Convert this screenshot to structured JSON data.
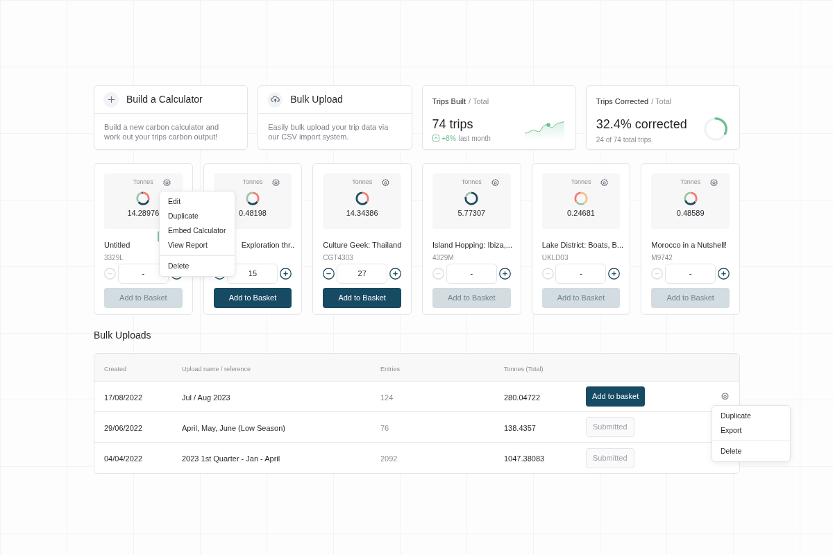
{
  "actions": [
    {
      "kind": "build",
      "title": "Build a Calculator",
      "description": "Build a new carbon calculator and work out your trips carbon output!"
    },
    {
      "kind": "upload",
      "title": "Bulk Upload",
      "description": "Easily bulk upload your trip data via our CSV import system."
    }
  ],
  "stats": [
    {
      "kind": "sparkline",
      "title": "Trips Built",
      "subtitle": "/ Total",
      "value": "74 trips",
      "change": "+8%",
      "change_note": "last month"
    },
    {
      "kind": "ring",
      "title": "Trips Corrected",
      "subtitle": "/ Total",
      "value": "32.4% corrected",
      "note": "24 of 74 total trips",
      "level": 0.324
    }
  ],
  "trips": [
    {
      "unit": "Tonnes",
      "tonnes": "14.28976",
      "name": "Untitled",
      "code": "3329L",
      "quantity": "-",
      "can_decrease": false,
      "can_add": false,
      "badge": true,
      "button": "Add to Basket"
    },
    {
      "unit": "Tonnes",
      "tonnes": "0.48198",
      "name": "Exploration thr..",
      "hidden_start": true,
      "quantity": "15",
      "can_decrease": true,
      "can_add": true,
      "button": "Add to Basket"
    },
    {
      "unit": "Tonnes",
      "tonnes": "14.34386",
      "name": "Culture Geek: Thailand",
      "code": "CGT4303",
      "quantity": "27",
      "can_decrease": true,
      "can_add": true,
      "button": "Add to Basket"
    },
    {
      "unit": "Tonnes",
      "tonnes": "5.77307",
      "name": "Island Hopping: Ibiza,...",
      "code": "4329M",
      "quantity": "-",
      "can_decrease": false,
      "can_add": false,
      "button": "Add to Basket"
    },
    {
      "unit": "Tonnes",
      "tonnes": "0.24681",
      "name": "Lake District: Boats, B...",
      "code": "UKLD03",
      "quantity": "-",
      "can_decrease": false,
      "can_add": false,
      "button": "Add to Basket"
    },
    {
      "unit": "Tonnes",
      "tonnes": "0.48589",
      "name": "Morocco in a Nutshell!",
      "code": "M9742",
      "quantity": "-",
      "can_decrease": false,
      "can_add": false,
      "button": "Add to Basket"
    }
  ],
  "trip_menu": {
    "items": [
      {
        "label": "Edit",
        "divider_before": false
      },
      {
        "label": "Duplicate",
        "divider_before": false
      },
      {
        "label": "Embed Calculator",
        "divider_before": false
      },
      {
        "label": "View Report",
        "divider_before": false
      },
      {
        "label": "Delete",
        "divider_before": true
      }
    ]
  },
  "bulk_uploads": {
    "title": "Bulk Uploads",
    "columns": [
      "Created",
      "Upload name / reference",
      "Entries",
      "Tonnes (Total)"
    ],
    "rows": [
      {
        "created": "17/08/2022",
        "name": "Jul / Aug 2023",
        "entries": "124",
        "tonnes": "280.04722",
        "action": "Add to basket",
        "disabled": false,
        "menu_open": true
      },
      {
        "created": "29/06/2022",
        "name": "April, May, June (Low Season)",
        "entries": "76",
        "tonnes": "138.4357",
        "action": "Submitted",
        "disabled": true,
        "menu_open": false
      },
      {
        "created": "04/04/2022",
        "name": "2023 1st Quarter - Jan - April",
        "entries": "2092",
        "tonnes": "1047.38083",
        "action": "Submitted",
        "disabled": true,
        "menu_open": false
      }
    ],
    "row_menu": {
      "items": [
        {
          "label": "Duplicate",
          "divider_before": false
        },
        {
          "label": "Export",
          "divider_before": false
        },
        {
          "label": "Delete",
          "divider_before": true
        }
      ]
    }
  }
}
